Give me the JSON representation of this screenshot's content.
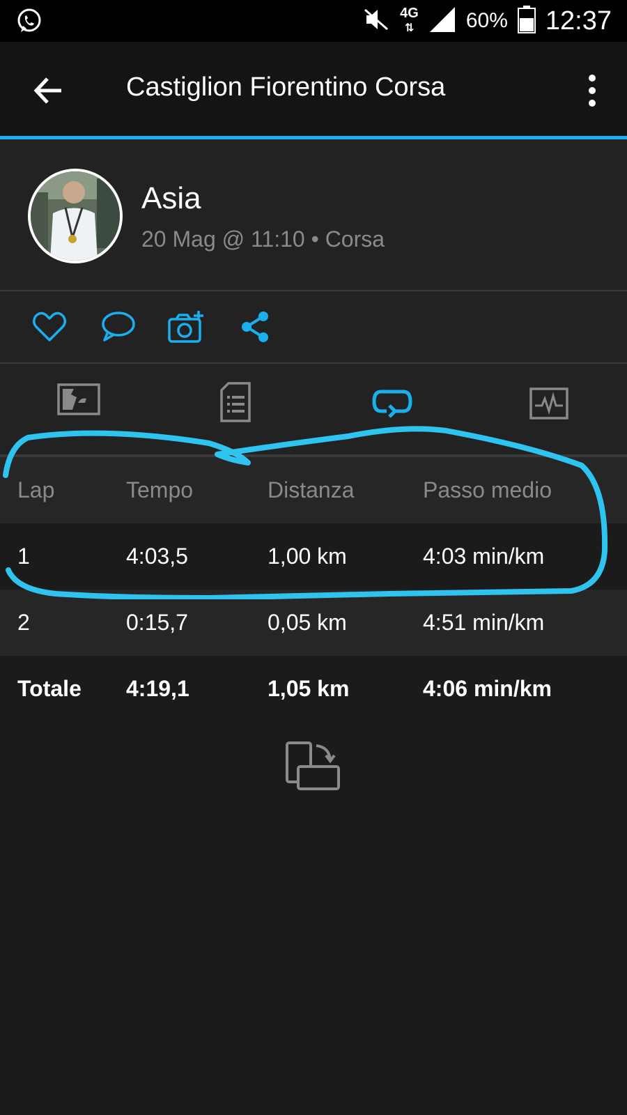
{
  "status_bar": {
    "app_notification_icon": "whatsapp-icon",
    "mute_icon": "mute-icon",
    "network": "4G",
    "signal_icon": "signal-icon",
    "battery": "60%",
    "battery_icon": "battery-icon",
    "time": "12:37"
  },
  "app_bar": {
    "back_icon": "arrow-left-icon",
    "title": "Castiglion Fiorentino Corsa",
    "menu_icon": "more-vertical-icon"
  },
  "profile": {
    "name": "Asia",
    "meta": "20 Mag @ 11:10 • Corsa"
  },
  "actions": [
    "heart-icon",
    "comment-icon",
    "add-photo-icon",
    "share-icon"
  ],
  "tabs": [
    {
      "icon": "map-icon",
      "active": false
    },
    {
      "icon": "details-icon",
      "active": false
    },
    {
      "icon": "laps-icon",
      "active": true
    },
    {
      "icon": "chart-icon",
      "active": false
    }
  ],
  "laps_table": {
    "columns": [
      "Lap",
      "Tempo",
      "Distanza",
      "Passo medio"
    ],
    "rows": [
      [
        "1",
        "4:03,5",
        "1,00 km",
        "4:03 min/km"
      ],
      [
        "2",
        "0:15,7",
        "0,05 km",
        "4:51 min/km"
      ]
    ],
    "total": [
      "Totale",
      "4:19,1",
      "1,05 km",
      "4:06 min/km"
    ]
  },
  "rotate_icon": "screen-rotate-icon",
  "colors": {
    "accent": "#1ab0ef",
    "background": "#1b1b1b",
    "panel": "#222222",
    "muted_text": "#8a8a8a"
  }
}
